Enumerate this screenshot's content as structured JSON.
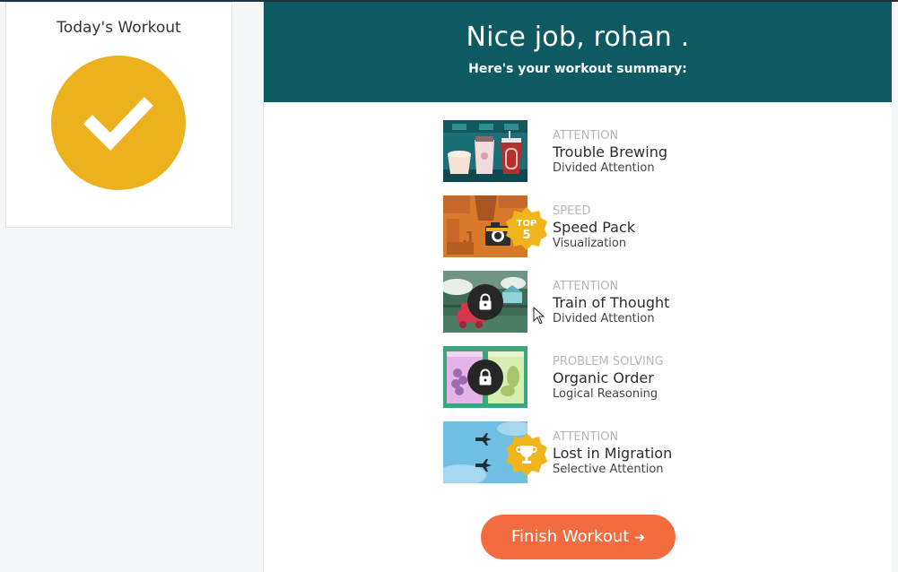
{
  "sidebar": {
    "card_title": "Today's Workout",
    "status_icon": "checkmark-icon",
    "accent_color": "#ecb21d"
  },
  "header": {
    "title": "Nice job, rohan .",
    "subtitle": "Here's your workout summary:",
    "background": "#0d5a62"
  },
  "games": [
    {
      "category": "ATTENTION",
      "name": "Trouble Brewing",
      "skill": "Divided Attention",
      "state": "played"
    },
    {
      "category": "SPEED",
      "name": "Speed Pack",
      "skill": "Visualization",
      "badge_top": "TOP",
      "badge_rank": "5"
    },
    {
      "category": "ATTENTION",
      "name": "Train of Thought",
      "skill": "Divided Attention",
      "state": "locked"
    },
    {
      "category": "PROBLEM SOLVING",
      "name": "Organic Order",
      "skill": "Logical Reasoning",
      "state": "locked"
    },
    {
      "category": "ATTENTION",
      "name": "Lost in Migration",
      "skill": "Selective Attention",
      "badge": "trophy-icon"
    }
  ],
  "finish_button": {
    "label": "Finish Workout",
    "arrow": "➜",
    "color": "#f26c3f"
  }
}
